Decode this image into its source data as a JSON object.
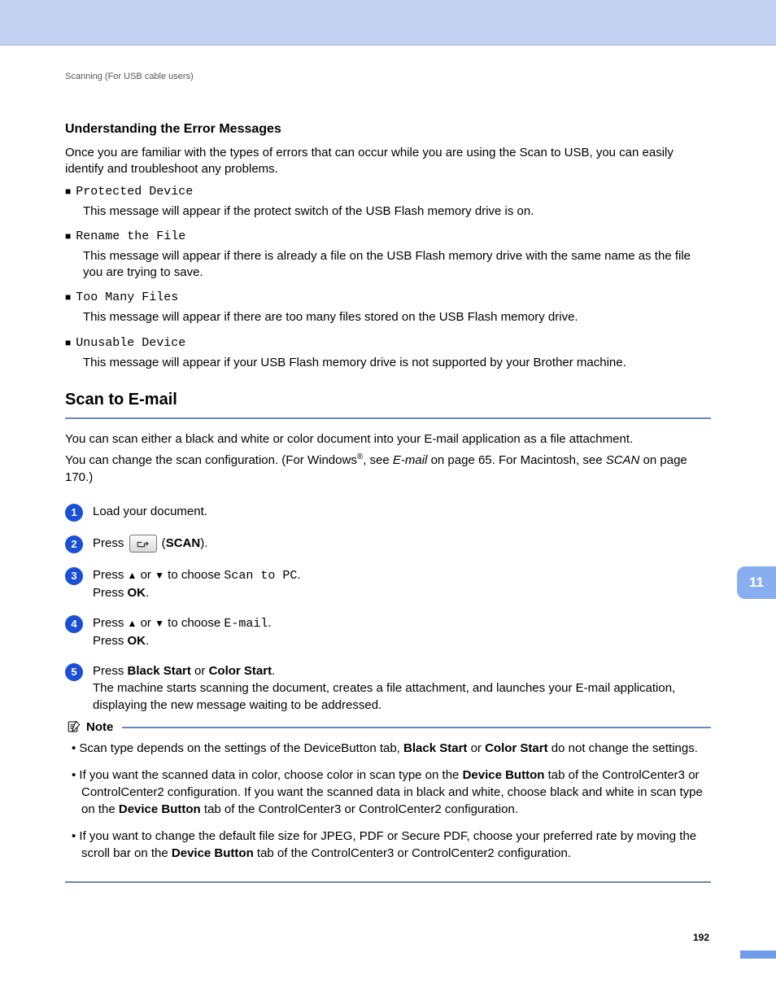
{
  "running_head": "Scanning (For USB cable users)",
  "chapter_tab": "11",
  "section_errors": {
    "heading": "Understanding the Error Messages",
    "intro": "Once you are familiar with the types of errors that can occur while you are using the Scan to USB, you can easily identify and troubleshoot any problems.",
    "items": [
      {
        "code": "Protected Device",
        "desc": "This message will appear if the protect switch of the USB Flash memory drive is on."
      },
      {
        "code": "Rename the File",
        "desc": "This message will appear if there is already a file on the USB Flash memory drive with the same name as the file you are trying to save."
      },
      {
        "code": "Too Many Files",
        "desc": "This message will appear if there are too many files stored on the USB Flash memory drive."
      },
      {
        "code": "Unusable Device",
        "desc": "This message will appear if your USB Flash memory drive is not supported by your Brother machine."
      }
    ]
  },
  "section_email": {
    "heading": "Scan to E-mail",
    "intro_line1": "You can scan either a black and white or color document into your E-mail application as a file attachment.",
    "intro_line2a": "You can change the scan configuration. (For Windows",
    "intro_line2_sup": "®",
    "intro_line2b": ",  see ",
    "intro_line2_em": "E-mail",
    "intro_line2c": " on page 65. For Macintosh, see ",
    "intro_line2_em2": "SCAN",
    "intro_line2d": " on page 170.)",
    "steps": {
      "s1": "Load your document.",
      "s2_a": "Press ",
      "s2_b": " (",
      "s2_scan": "SCAN",
      "s2_c": ").",
      "s3_a": "Press ",
      "s3_up": "▲",
      "s3_or": " or ",
      "s3_down": "▼",
      "s3_b": " to choose ",
      "s3_choice": "Scan to PC",
      "s3_c": ".",
      "s3_d": "Press ",
      "s3_ok": "OK",
      "s3_e": ".",
      "s4_choice": "E-mail",
      "s5_a": "Press ",
      "s5_black": "Black Start",
      "s5_or": " or ",
      "s5_color": "Color Start",
      "s5_b": ".",
      "s5_body": "The machine starts scanning the document, creates a file attachment, and launches your E-mail application, displaying the new message waiting to be addressed."
    }
  },
  "note": {
    "label": "Note",
    "items": [
      {
        "pre": "Scan type depends on the settings of the DeviceButton tab, ",
        "b1": "Black Start",
        "mid": " or ",
        "b2": "Color Start",
        "post": " do not change the settings."
      },
      {
        "pre": "If you want the scanned data in color, choose color in scan type on the ",
        "b1": "Device Button",
        "mid": " tab of the ControlCenter3 or ControlCenter2 configuration. If you want the scanned data in black and white, choose black and white in scan type on the ",
        "b2": "Device Button",
        "post": " tab of the ControlCenter3 or ControlCenter2 configuration."
      },
      {
        "pre": "If you want to change the default file size for JPEG, PDF or Secure PDF, choose your preferred rate by moving the scroll bar on the ",
        "b1": "Device Button",
        "mid": "",
        "b2": "",
        "post": " tab of the ControlCenter3 or ControlCenter2 configuration."
      }
    ]
  },
  "page_number": "192"
}
